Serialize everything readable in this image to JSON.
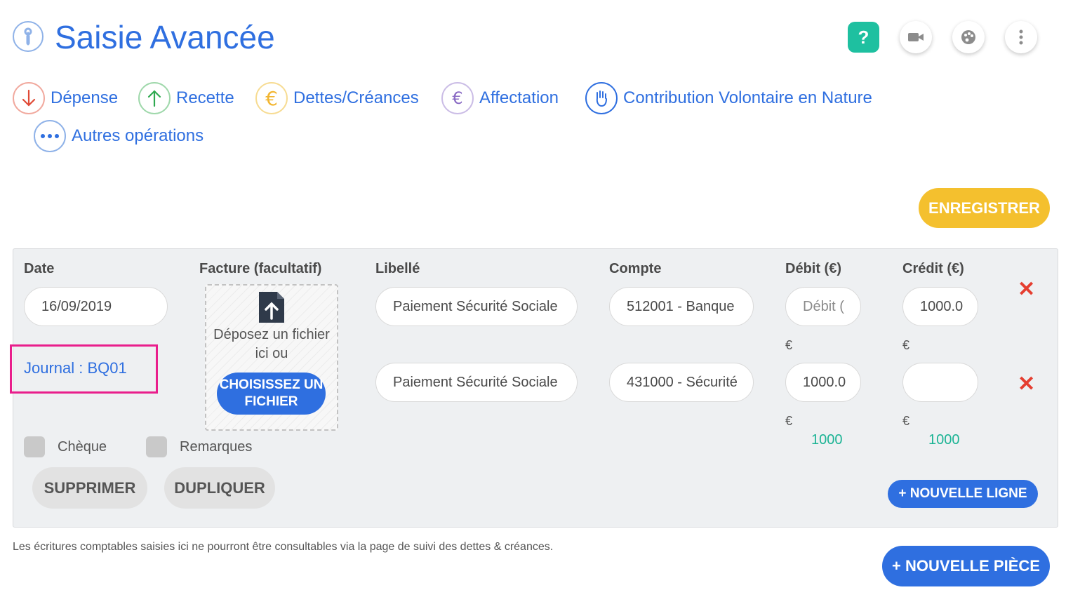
{
  "header": {
    "title": "Saisie Avancée",
    "help_label": "?",
    "icons": [
      "wrench-icon",
      "help-icon",
      "video-icon",
      "palette-icon",
      "more-vertical-icon"
    ]
  },
  "operations": [
    {
      "label": "Dépense",
      "icon": "arrow-down-icon",
      "color": "#e04a36"
    },
    {
      "label": "Recette",
      "icon": "arrow-up-icon",
      "color": "#2ea84f"
    },
    {
      "label": "Dettes/Créances",
      "icon": "euro-icon",
      "color": "#f2b632"
    },
    {
      "label": "Affectation",
      "icon": "euro-exchange-icon",
      "color": "#8a6bc4"
    },
    {
      "label": "Contribution Volontaire en Nature",
      "icon": "hand-icon",
      "color": "#2f6fe0"
    },
    {
      "label": "Autres opérations",
      "icon": "dots-icon",
      "color": "#2f6fe0"
    }
  ],
  "save_label": "ENREGISTRER",
  "entry": {
    "columns": {
      "date": "Date",
      "invoice": "Facture (facultatif)",
      "label": "Libellé",
      "account": "Compte",
      "debit": "Débit (€)",
      "credit": "Crédit (€)"
    },
    "date_value": "16/09/2019",
    "journal": "Journal : BQ01",
    "dropzone_text": "Déposez un fichier ici ou",
    "choose_file_label": "CHOISISSEZ UN FICHIER",
    "rows": [
      {
        "label": "Paiement Sécurité Sociale",
        "account": "512001 - Banque",
        "debit": "",
        "debit_placeholder": "Débit (",
        "credit": "1000.0",
        "credit_placeholder": ""
      },
      {
        "label": "Paiement Sécurité Sociale",
        "account": "431000 - Sécurité",
        "debit": "1000.0",
        "debit_placeholder": "",
        "credit": "",
        "credit_placeholder": ""
      }
    ],
    "currency": "€",
    "total_debit": "1000",
    "total_credit": "1000",
    "cheque_label": "Chèque",
    "remarks_label": "Remarques",
    "delete_label": "SUPPRIMER",
    "duplicate_label": "DUPLIQUER",
    "new_line_label": "+ NOUVELLE LIGNE",
    "remove_symbol": "✕"
  },
  "footnote": "Les écritures comptables saisies ici ne pourront être consultables via la page de suivi des dettes & créances.",
  "new_piece_label": "+ NOUVELLE PIÈCE"
}
